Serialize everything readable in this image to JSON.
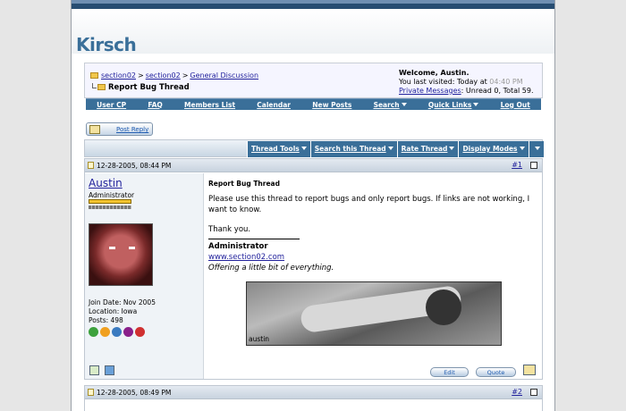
{
  "site": {
    "logo": "Kirsch"
  },
  "breadcrumb": {
    "items": [
      "section02",
      "section02",
      "General Discussion"
    ],
    "separator": ">",
    "current": "Report Bug Thread"
  },
  "welcome": {
    "greeting": "Welcome, Austin.",
    "last_visited_label": "You last visited: Today at",
    "last_visited_time": "04:40 PM",
    "pm_link": "Private Messages",
    "pm_status": ": Unread 0, Total 59."
  },
  "menu": {
    "items": [
      "User CP",
      "FAQ",
      "Members List",
      "Calendar",
      "New Posts",
      "Search",
      "Quick Links",
      "Log Out"
    ]
  },
  "post_reply_label": "Post Reply",
  "thread_tools": [
    "Thread Tools",
    "Search this Thread",
    "Rate Thread",
    "Display Modes"
  ],
  "posts": [
    {
      "date": "12-28-2005, 08:44 PM",
      "number": "#1",
      "username": "Austin",
      "user_title": "Administrator",
      "join_date": "Join Date: Nov 2005",
      "location": "Location: Iowa",
      "posts_count": "Posts: 498",
      "title": "Report Bug Thread",
      "body_line1": "Please use this thread to report bugs and only report bugs. If links are not working, I want to know.",
      "body_line2": "Thank you.",
      "sig_name": "Administrator",
      "sig_link": "www.section02.com",
      "sig_tagline": "Offering a little bit of everything.",
      "sig_image_caption": "austin",
      "edit_label": "Edit",
      "quote_label": "Quote"
    },
    {
      "date": "12-28-2005, 08:49 PM",
      "number": "#2"
    }
  ],
  "colors": {
    "primary": "#3a6f99",
    "link": "#22229c",
    "header_dark": "#274d72"
  }
}
